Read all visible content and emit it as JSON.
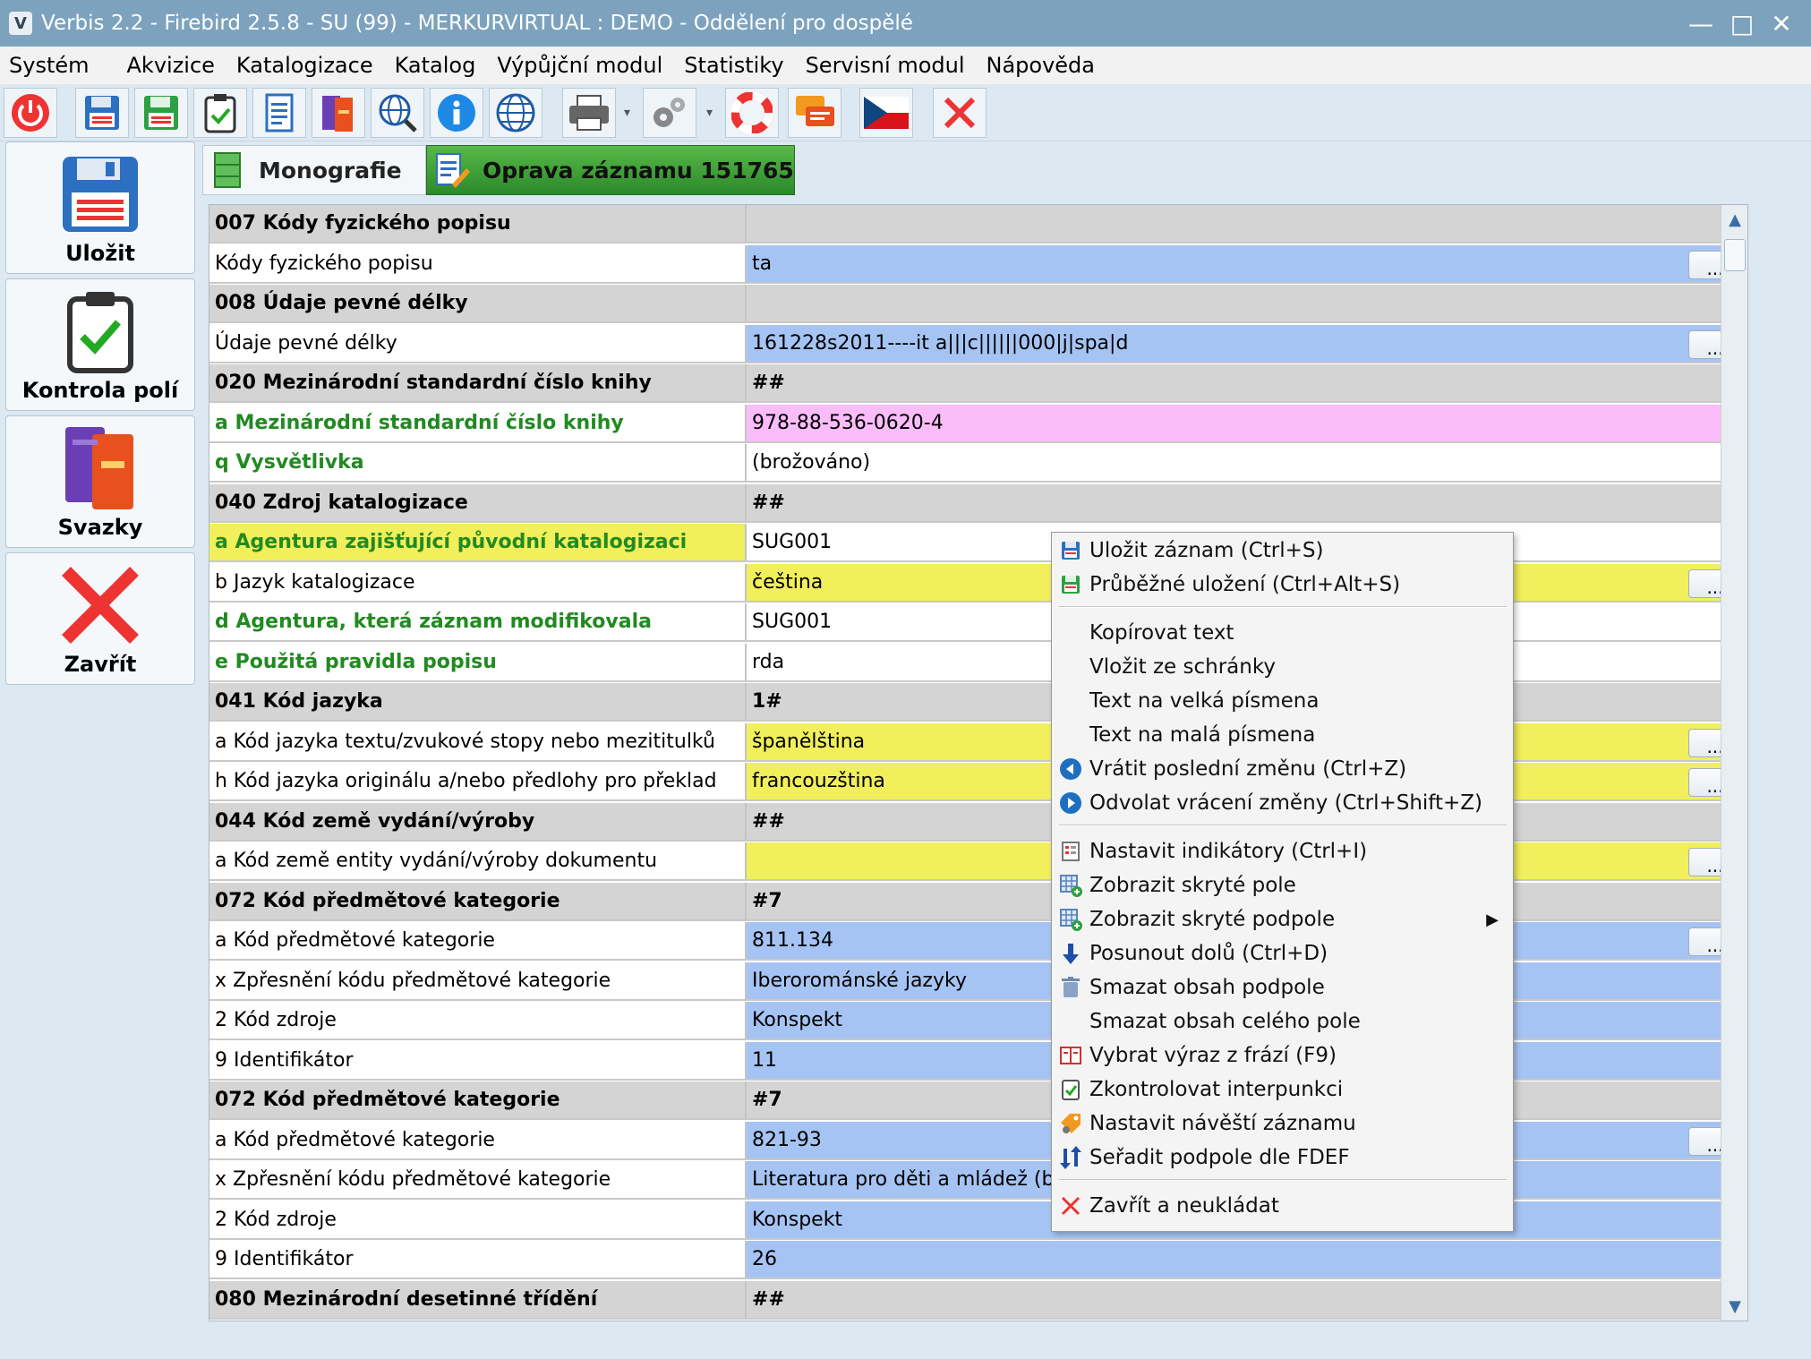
{
  "window": {
    "title": "Verbis 2.2 - Firebird 2.5.8 - SU (99) - MERKURVIRTUAL : DEMO - Oddělení pro dospělé"
  },
  "menu": [
    "Systém",
    "Akvizice",
    "Katalogizace",
    "Katalog",
    "Výpůjční modul",
    "Statistiky",
    "Servisní modul",
    "Nápověda"
  ],
  "toolbar": {
    "icons": [
      "power-icon",
      "save-icon",
      "save-green-icon",
      "clipboard-check-icon",
      "document-icon",
      "books-icon",
      "globe-search-icon",
      "info-icon",
      "globe-icon",
      "printer-icon",
      "gears-icon",
      "lifebuoy-icon",
      "chat-icon",
      "czech-flag-icon",
      "close-icon"
    ]
  },
  "left_buttons": [
    "Uložit",
    "Kontrola polí",
    "Svazky",
    "Zavřít"
  ],
  "tabs": [
    "Monografie",
    "Oprava záznamu 151765"
  ],
  "rows": [
    {
      "kind": "field",
      "label": "007 Kódy fyzického popisu",
      "value": ""
    },
    {
      "kind": "sub",
      "label": "Kódy fyzického popisu",
      "value": "ta",
      "bg": "blue",
      "dots": true
    },
    {
      "kind": "field",
      "label": "008 Údaje pevné délky",
      "value": ""
    },
    {
      "kind": "sub",
      "label": "Údaje pevné délky",
      "value": "161228s2011----it a|||c||||||000|j|spa|d",
      "bg": "blue",
      "dots": true
    },
    {
      "kind": "field",
      "label": "020 Mezinárodní standardní číslo knihy",
      "value": "##"
    },
    {
      "kind": "sub",
      "label": "a Mezinárodní standardní číslo knihy",
      "value": "978-88-536-0620-4",
      "bg": "pink",
      "green": true
    },
    {
      "kind": "sub",
      "label": "q Vysvětlivka",
      "value": "(brožováno)",
      "bg": "white",
      "green": true
    },
    {
      "kind": "field",
      "label": "040 Zdroj katalogizace",
      "value": "##"
    },
    {
      "kind": "sub",
      "label": "a Agentura zajišťující původní katalogizaci",
      "value": "SUG001",
      "bg": "white",
      "green": true,
      "labelbg": "yellow"
    },
    {
      "kind": "sub",
      "label": "b Jazyk katalogizace",
      "value": "čeština",
      "bg": "yellow",
      "dots": true
    },
    {
      "kind": "sub",
      "label": "d Agentura, která záznam modifikovala",
      "value": "SUG001",
      "bg": "white",
      "green": true
    },
    {
      "kind": "sub",
      "label": "e Použitá pravidla popisu",
      "value": "rda",
      "bg": "white",
      "green": true
    },
    {
      "kind": "field",
      "label": "041 Kód jazyka",
      "value": "1#"
    },
    {
      "kind": "sub",
      "label": "a Kód jazyka textu/zvukové stopy nebo mezititulků",
      "value": "španělština",
      "bg": "yellow",
      "dots": true
    },
    {
      "kind": "sub",
      "label": "h Kód jazyka originálu a/nebo předlohy pro překlad",
      "value": "francouzština",
      "bg": "yellow",
      "dots": true
    },
    {
      "kind": "field",
      "label": "044 Kód země vydání/výroby",
      "value": "##"
    },
    {
      "kind": "sub",
      "label": "a Kód země entity vydání/výroby dokumentu",
      "value": "",
      "bg": "yellow",
      "dots": true
    },
    {
      "kind": "field",
      "label": "072 Kód předmětové kategorie",
      "value": "#7"
    },
    {
      "kind": "sub",
      "label": "a Kód předmětové kategorie",
      "value": "811.134",
      "bg": "blue",
      "dots": true
    },
    {
      "kind": "sub",
      "label": "x Zpřesnění kódu předmětové kategorie",
      "value": "Iberorománské jazyky",
      "bg": "blue"
    },
    {
      "kind": "sub",
      "label": "2 Kód zdroje",
      "value": "Konspekt",
      "bg": "blue"
    },
    {
      "kind": "sub",
      "label": "9 Identifikátor",
      "value": "11",
      "bg": "blue"
    },
    {
      "kind": "field",
      "label": "072 Kód předmětové kategorie",
      "value": "#7"
    },
    {
      "kind": "sub",
      "label": "a Kód předmětové kategorie",
      "value": "821-93",
      "bg": "blue",
      "dots": true
    },
    {
      "kind": "sub",
      "label": "x Zpřesnění kódu předmětové kategorie",
      "value": "Literatura pro děti a mládež (beletr",
      "bg": "blue"
    },
    {
      "kind": "sub",
      "label": "2 Kód zdroje",
      "value": "Konspekt",
      "bg": "blue"
    },
    {
      "kind": "sub",
      "label": "9 Identifikátor",
      "value": "26",
      "bg": "blue"
    },
    {
      "kind": "field",
      "label": "080 Mezinárodní desetinné třídění",
      "value": "##"
    }
  ],
  "dots_label": "...",
  "context_menu": [
    {
      "label": "Uložit záznam (Ctrl+S)",
      "icon": "save-icon"
    },
    {
      "label": "Průběžné uložení (Ctrl+Alt+S)",
      "icon": "save-green-icon"
    },
    {
      "sep": true
    },
    {
      "label": "Kopírovat text",
      "icon": ""
    },
    {
      "label": "Vložit ze schránky",
      "icon": ""
    },
    {
      "label": "Text na velká písmena",
      "icon": ""
    },
    {
      "label": "Text na malá písmena",
      "icon": ""
    },
    {
      "label": "Vrátit poslední změnu (Ctrl+Z)",
      "icon": "undo-icon"
    },
    {
      "label": "Odvolat vrácení změny (Ctrl+Shift+Z)",
      "icon": "redo-icon"
    },
    {
      "sep": true
    },
    {
      "label": "Nastavit indikátory (Ctrl+I)",
      "icon": "indicators-icon"
    },
    {
      "label": "Zobrazit skryté pole",
      "icon": "grid-add-icon"
    },
    {
      "label": "Zobrazit skryté podpole",
      "icon": "grid-add-icon",
      "submenu": true
    },
    {
      "label": "Posunout dolů (Ctrl+D)",
      "icon": "arrow-down-icon"
    },
    {
      "label": "Smazat obsah podpole",
      "icon": "trash-icon"
    },
    {
      "label": "Smazat obsah celého pole",
      "icon": ""
    },
    {
      "label": "Vybrat výraz z frází (F9)",
      "icon": "phrase-book-icon"
    },
    {
      "label": "Zkontrolovat interpunkci",
      "icon": "checklist-icon"
    },
    {
      "label": "Nastavit návěští záznamu",
      "icon": "tag-icon"
    },
    {
      "label": "Seřadit podpole dle FDEF",
      "icon": "sort-icon"
    },
    {
      "sep": true
    },
    {
      "label": "Zavřít a neukládat",
      "icon": "close-icon"
    }
  ],
  "colors": {
    "field_bg": "#d4d4d4",
    "blue": "#a6c4f3",
    "yellow": "#f1ef5b",
    "pink": "#fbbdf9",
    "green_text": "#218a21",
    "tab_active": "#3a9a34"
  }
}
